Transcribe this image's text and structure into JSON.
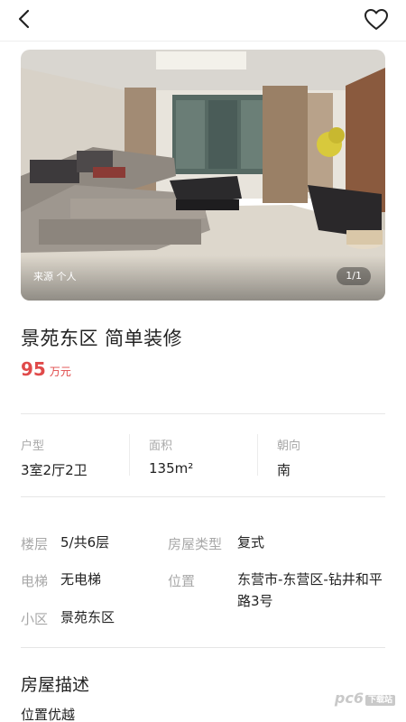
{
  "header": {
    "back_icon": "chevron-left-icon",
    "favorite_icon": "heart-outline-icon"
  },
  "photo": {
    "source_label": "来源 个人",
    "counter": "1/1"
  },
  "listing": {
    "title": "景苑东区 简单装修",
    "price": "95",
    "price_unit": "万元"
  },
  "stats": [
    {
      "label": "户型",
      "value": "3室2厅2卫"
    },
    {
      "label": "面积",
      "value": "135m²"
    },
    {
      "label": "朝向",
      "value": "南"
    }
  ],
  "details": {
    "floor_label": "楼层",
    "floor_value": "5/共6层",
    "type_label": "房屋类型",
    "type_value": "复式",
    "elevator_label": "电梯",
    "elevator_value": "无电梯",
    "location_label": "位置",
    "location_value": "东营市-东营区-钻井和平路3号",
    "community_label": "小区",
    "community_value": "景苑东区"
  },
  "description": {
    "title": "房屋描述",
    "text": "位置优越"
  },
  "watermark": {
    "text": "pc6",
    "suffix": "下载站"
  },
  "colors": {
    "price": "#e04a4a",
    "label_gray": "#a8a8a8",
    "divider": "#e6e6e6"
  }
}
